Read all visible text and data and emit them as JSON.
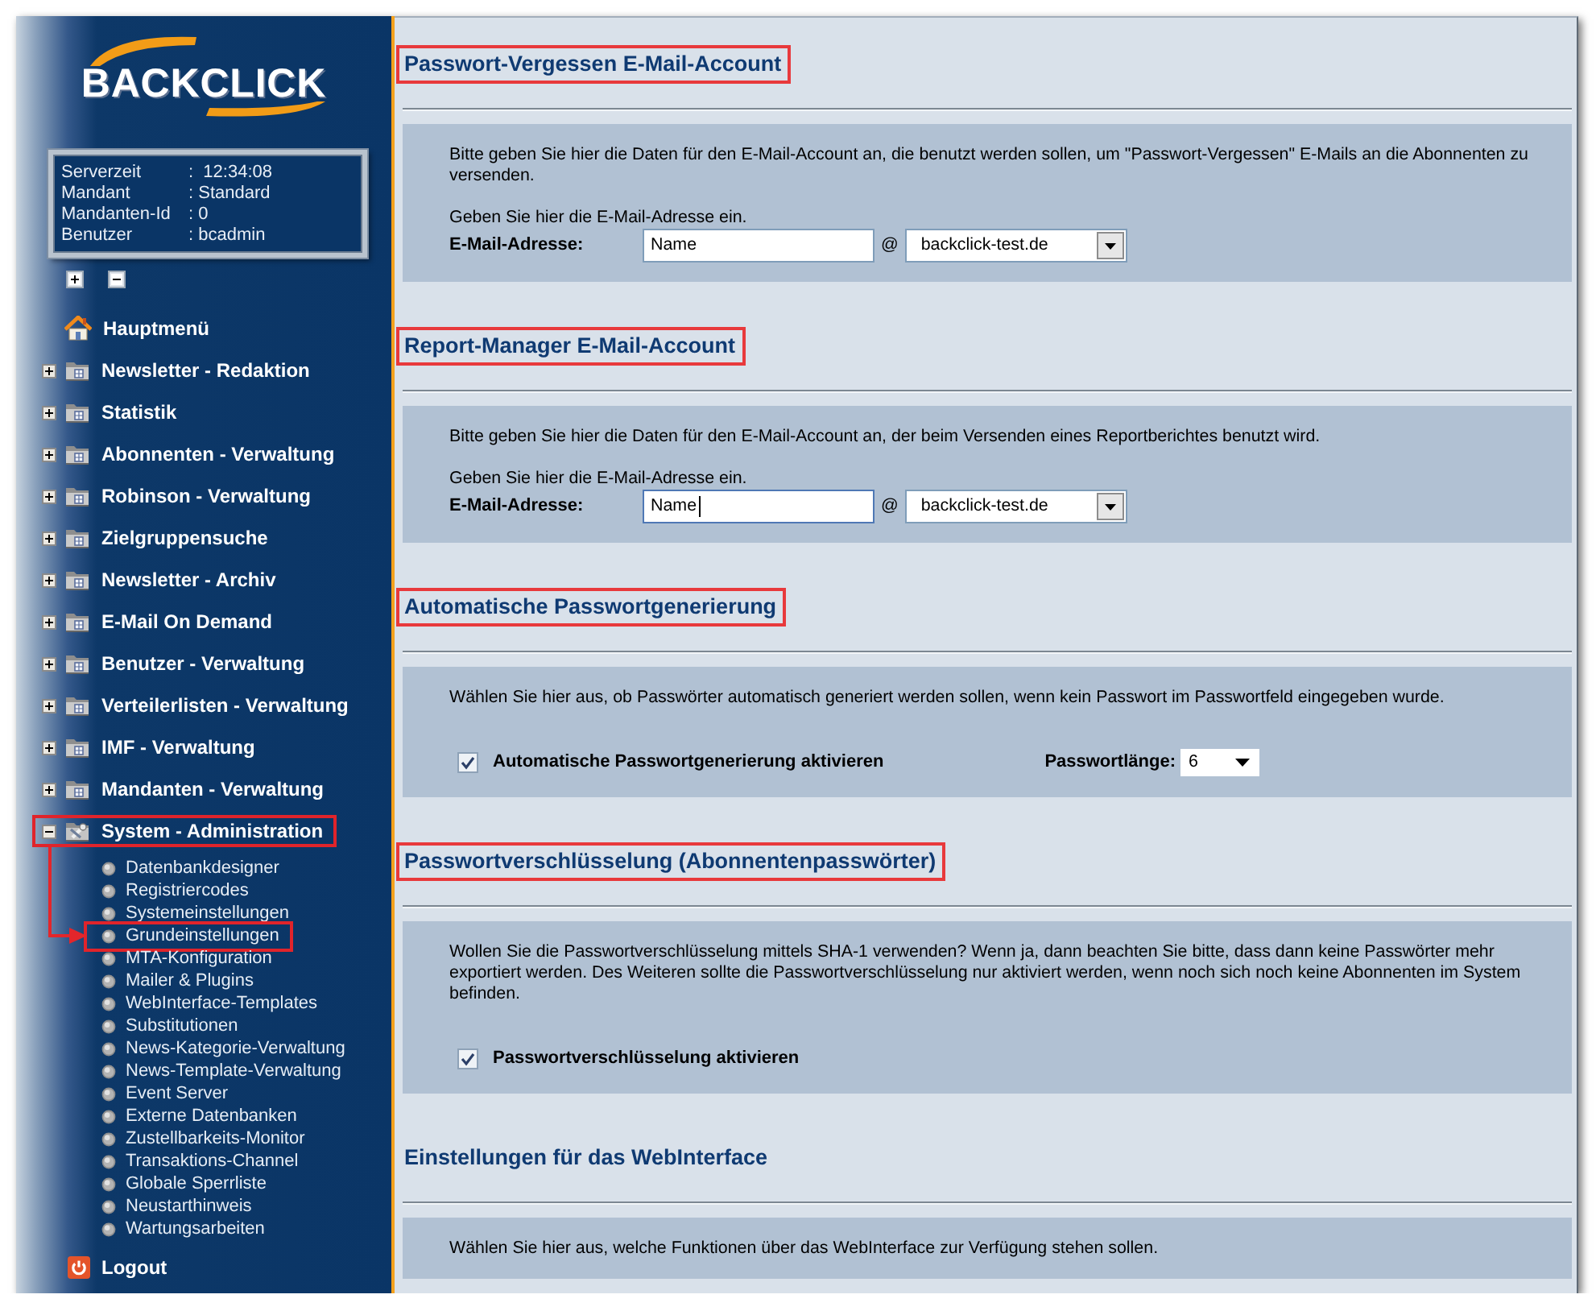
{
  "logo": {
    "text": "BACKCLICK"
  },
  "server_info": [
    {
      "label": "Serverzeit",
      "value": ":  12:34:08"
    },
    {
      "label": "Mandant",
      "value": ": Standard"
    },
    {
      "label": "Mandanten-Id",
      "value": ": 0"
    },
    {
      "label": "Benutzer",
      "value": ": bcadmin"
    }
  ],
  "menu": {
    "home": {
      "label": "Hauptmenü"
    },
    "items": [
      {
        "label": "Newsletter - Redaktion",
        "kind": "folder",
        "expanded": false,
        "highlighted": false
      },
      {
        "label": "Statistik",
        "kind": "folder",
        "expanded": false,
        "highlighted": false
      },
      {
        "label": "Abonnenten - Verwaltung",
        "kind": "folder",
        "expanded": false,
        "highlighted": false
      },
      {
        "label": "Robinson - Verwaltung",
        "kind": "folder",
        "expanded": false,
        "highlighted": false
      },
      {
        "label": "Zielgruppensuche",
        "kind": "folder",
        "expanded": false,
        "highlighted": false
      },
      {
        "label": "Newsletter - Archiv",
        "kind": "folder",
        "expanded": false,
        "highlighted": false
      },
      {
        "label": "E-Mail On Demand",
        "kind": "folder",
        "expanded": false,
        "highlighted": false
      },
      {
        "label": "Benutzer - Verwaltung",
        "kind": "folder",
        "expanded": false,
        "highlighted": false
      },
      {
        "label": "Verteilerlisten - Verwaltung",
        "kind": "folder",
        "expanded": false,
        "highlighted": false
      },
      {
        "label": "IMF - Verwaltung",
        "kind": "folder",
        "expanded": false,
        "highlighted": false
      },
      {
        "label": "Mandanten - Verwaltung",
        "kind": "folder",
        "expanded": false,
        "highlighted": false
      },
      {
        "label": "System - Administration",
        "kind": "tools",
        "expanded": true,
        "highlighted": true,
        "children": [
          {
            "label": "Datenbankdesigner",
            "highlighted": false
          },
          {
            "label": "Registriercodes",
            "highlighted": false
          },
          {
            "label": "Systemeinstellungen",
            "highlighted": false
          },
          {
            "label": "Grundeinstellungen",
            "highlighted": true
          },
          {
            "label": "MTA-Konfiguration",
            "highlighted": false
          },
          {
            "label": "Mailer & Plugins",
            "highlighted": false
          },
          {
            "label": "WebInterface-Templates",
            "highlighted": false
          },
          {
            "label": "Substitutionen",
            "highlighted": false
          },
          {
            "label": "News-Kategorie-Verwaltung",
            "highlighted": false
          },
          {
            "label": "News-Template-Verwaltung",
            "highlighted": false
          },
          {
            "label": "Event Server",
            "highlighted": false
          },
          {
            "label": "Externe Datenbanken",
            "highlighted": false
          },
          {
            "label": "Zustellbarkeits-Monitor",
            "highlighted": false
          },
          {
            "label": "Transaktions-Channel",
            "highlighted": false
          },
          {
            "label": "Globale Sperrliste",
            "highlighted": false
          },
          {
            "label": "Neustarthinweis",
            "highlighted": false
          },
          {
            "label": "Wartungsarbeiten",
            "highlighted": false
          }
        ]
      }
    ],
    "logout": {
      "label": "Logout"
    }
  },
  "sections": [
    {
      "title": "Passwort-Vergessen E-Mail-Account",
      "highlighted": true,
      "description": "Bitte geben Sie hier die Daten für den E-Mail-Account an, die benutzt werden sollen, um \"Passwort-Vergessen\" E-Mails an die Abonnenten zu versenden.",
      "rows": [
        {
          "kind": "hint",
          "text": "Geben Sie hier die E-Mail-Adresse ein."
        },
        {
          "kind": "email",
          "label": "E-Mail-Adresse:",
          "local_part": "Name",
          "focused": false,
          "at": "@",
          "domain": "backclick-test.de"
        }
      ]
    },
    {
      "title": "Report-Manager E-Mail-Account",
      "highlighted": true,
      "description": "Bitte geben Sie hier die Daten für den E-Mail-Account an, der beim Versenden eines Reportberichtes benutzt wird.",
      "rows": [
        {
          "kind": "hint",
          "text": "Geben Sie hier die E-Mail-Adresse ein."
        },
        {
          "kind": "email",
          "label": "E-Mail-Adresse:",
          "local_part": "Name",
          "focused": true,
          "at": "@",
          "domain": "backclick-test.de"
        }
      ]
    },
    {
      "title": "Automatische Passwortgenerierung",
      "highlighted": true,
      "description": "Wählen Sie hier aus, ob Passwörter automatisch generiert werden sollen, wenn kein Passwort im Passwortfeld eingegeben wurde.",
      "rows": [
        {
          "kind": "checkbox",
          "label": "Automatische Passwortgenerierung aktivieren",
          "checked": true,
          "select_label": "Passwortlänge:",
          "select_value": "6"
        }
      ]
    },
    {
      "title": "Passwortverschlüsselung (Abonnentenpasswörter)",
      "highlighted": true,
      "description": "Wollen Sie die Passwortverschlüsselung mittels SHA-1 verwenden? Wenn ja, dann beachten Sie bitte, dass dann keine Passwörter mehr exportiert werden. Des Weiteren sollte die Passwortverschlüsselung nur aktiviert werden, wenn noch sich noch keine Abonnenten im System befinden.",
      "rows": [
        {
          "kind": "checkbox",
          "label": "Passwortverschlüsselung aktivieren",
          "checked": true
        }
      ]
    },
    {
      "title": "Einstellungen für das WebInterface",
      "highlighted": false,
      "description": "Wählen Sie hier aus, welche Funktionen über das WebInterface zur Verfügung stehen sollen."
    }
  ]
}
